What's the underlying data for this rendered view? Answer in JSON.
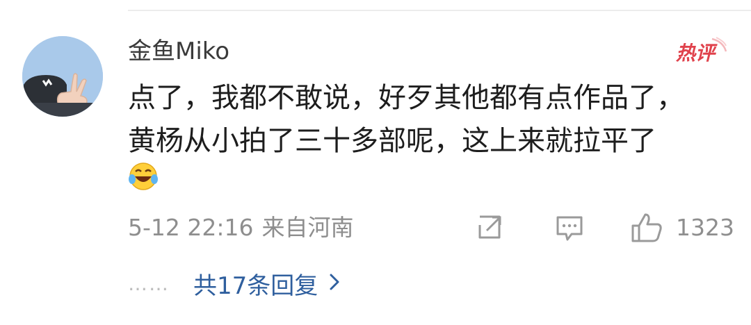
{
  "comment": {
    "username": "金鱼Miko",
    "badge_text": "热评",
    "text_lines": [
      "点了，我都不敢说，好歹其他都有点作品了，",
      "黄杨从小拍了三十多部呢，这上来就拉平了"
    ],
    "emoji": "laugh-cry-emoji",
    "date_time": "5-12 22:16",
    "region": "来自河南",
    "like_count": "1323",
    "dots": "……",
    "replies_label": "共17条回复",
    "icons": [
      "share-icon",
      "comment-icon",
      "thumbs-up-icon",
      "chevron-right-icon"
    ]
  },
  "colors": {
    "link": "#2f5f9e",
    "meta": "#8e8e8e",
    "badge": "#e0424c",
    "text": "#1d1d1d"
  }
}
